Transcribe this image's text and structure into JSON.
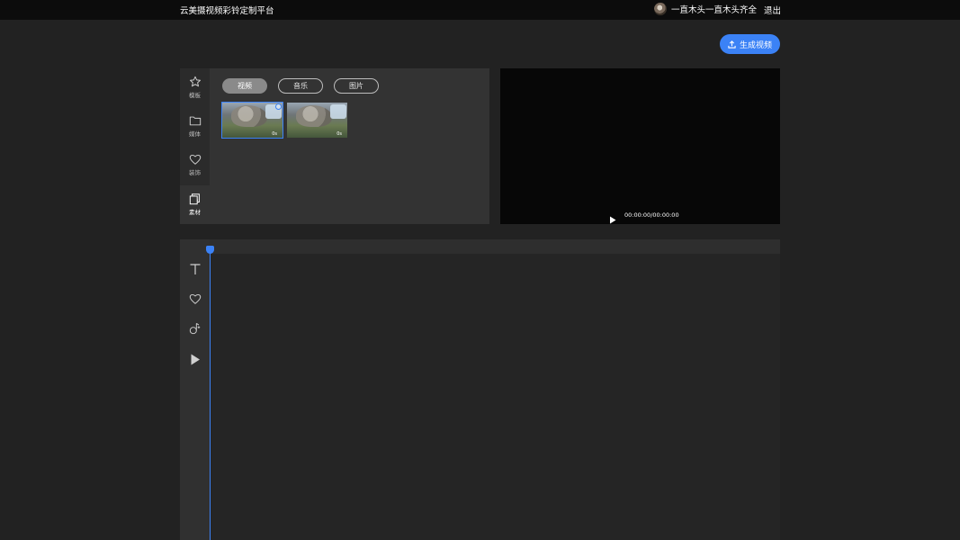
{
  "header": {
    "app_title": "云美摄视频彩铃定制平台",
    "username": "一直木头一直木头齐全",
    "logout_label": "退出"
  },
  "toolbar": {
    "generate_label": "生成视频"
  },
  "sidebar": {
    "items": [
      {
        "label": "模板",
        "icon": "star-icon"
      },
      {
        "label": "媒体",
        "icon": "folder-icon"
      },
      {
        "label": "装饰",
        "icon": "heart-icon"
      },
      {
        "label": "素材",
        "icon": "copy-icon",
        "active": true
      }
    ]
  },
  "library": {
    "tabs": [
      {
        "label": "视频",
        "active": true
      },
      {
        "label": "音乐"
      },
      {
        "label": "图片"
      }
    ],
    "thumbnails": [
      {
        "duration": "0s",
        "selected": true
      },
      {
        "duration": "0s",
        "selected": false
      }
    ]
  },
  "preview": {
    "time": "00:00:00/00:00:00"
  },
  "timeline": {
    "tools": [
      "text-icon",
      "heart-icon",
      "music-note-icon",
      "play-icon"
    ]
  },
  "colors": {
    "accent": "#3b82f6",
    "background": "#222222",
    "topbar": "#0c0c0c"
  }
}
